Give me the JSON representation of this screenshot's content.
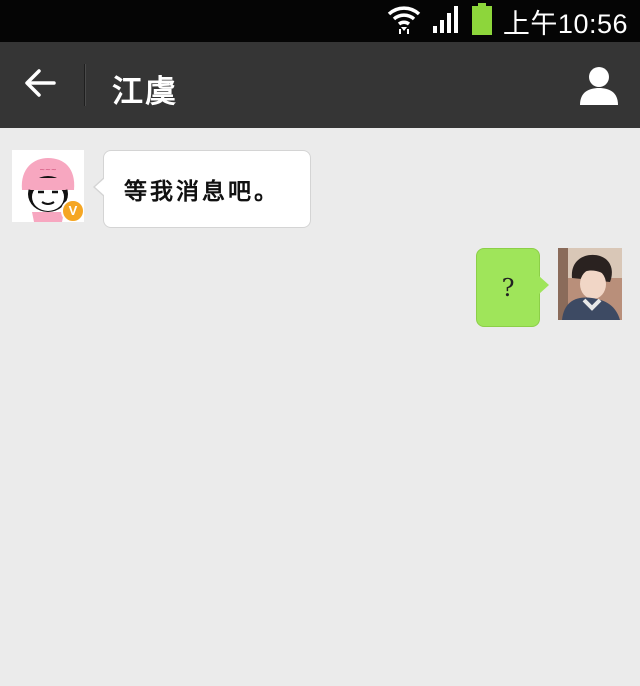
{
  "status_bar": {
    "time": "上午10:56",
    "icons": [
      "wifi-icon",
      "signal-icon",
      "battery-icon"
    ],
    "battery_color": "#8dd63b"
  },
  "header": {
    "title": "江虞",
    "back_icon": "back-arrow-icon",
    "profile_icon": "profile-icon",
    "background": "#353535"
  },
  "messages": [
    {
      "sender": "other",
      "avatar_icon": "helmet-avatar-icon",
      "badge": "V",
      "text": "等我消息吧。"
    },
    {
      "sender": "self",
      "avatar_icon": "user-photo-avatar",
      "text": "?"
    }
  ],
  "colors": {
    "chat_background": "#ebebeb",
    "incoming_bubble": "#ffffff",
    "outgoing_bubble": "#9fe55a",
    "badge": "#f5a623"
  }
}
